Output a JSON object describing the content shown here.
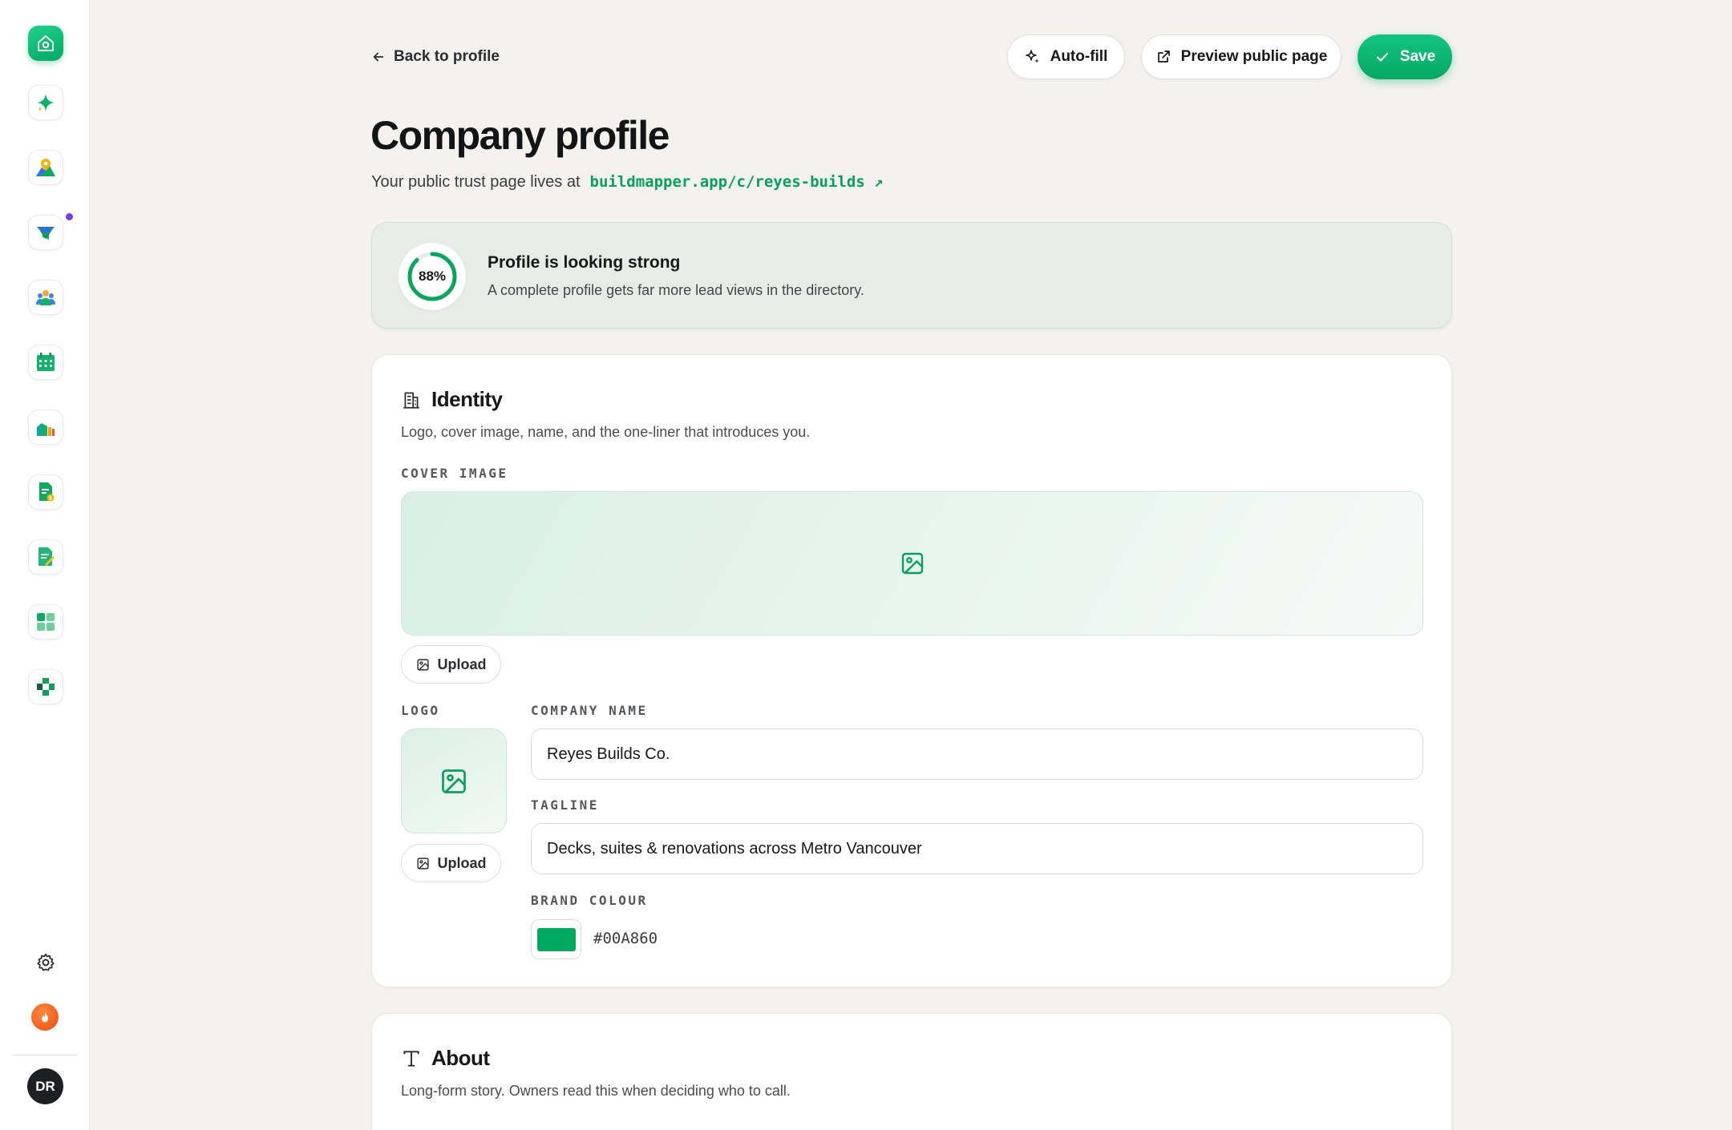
{
  "header": {
    "back_label": "Back to profile",
    "autofill_label": "Auto-fill",
    "preview_label": "Preview public page",
    "save_label": "Save"
  },
  "page": {
    "title": "Company profile",
    "subtitle_prefix": "Your public trust page lives at",
    "public_url": "buildmapper.app/c/reyes-builds ↗"
  },
  "status": {
    "percent": 88,
    "percent_label": "88%",
    "title": "Profile is looking strong",
    "description": "A complete profile gets far more lead views in the directory."
  },
  "identity": {
    "heading": "Identity",
    "description": "Logo, cover image, name, and the one-liner that introduces you.",
    "cover_label": "COVER IMAGE",
    "upload_label": "Upload",
    "logo_label": "LOGO",
    "logo_upload_label": "Upload",
    "company_name_label": "COMPANY NAME",
    "company_name_value": "Reyes Builds Co.",
    "tagline_label": "TAGLINE",
    "tagline_value": "Decks, suites & renovations across Metro Vancouver",
    "brand_colour_label": "BRAND COLOUR",
    "brand_colour_value": "#00A860"
  },
  "about": {
    "heading": "About",
    "description": "Long-form story. Owners read this when deciding who to call."
  },
  "user": {
    "initials": "DR"
  },
  "sidebar": {
    "items": [
      {
        "name": "home-icon"
      },
      {
        "name": "sparkle-icon"
      },
      {
        "name": "map-pin-icon"
      },
      {
        "name": "leads-funnel-icon"
      },
      {
        "name": "team-icon"
      },
      {
        "name": "calendar-icon"
      },
      {
        "name": "analytics-icon"
      },
      {
        "name": "invoice-icon"
      },
      {
        "name": "document-edit-icon"
      },
      {
        "name": "apps-grid-icon"
      },
      {
        "name": "integrations-icon"
      }
    ],
    "settings_icon": "gear-icon",
    "streak_icon": "flame-icon"
  },
  "colors": {
    "brand": "#00A860",
    "accent": "#0b9f5c",
    "notification_dot": "#7c3aed"
  }
}
